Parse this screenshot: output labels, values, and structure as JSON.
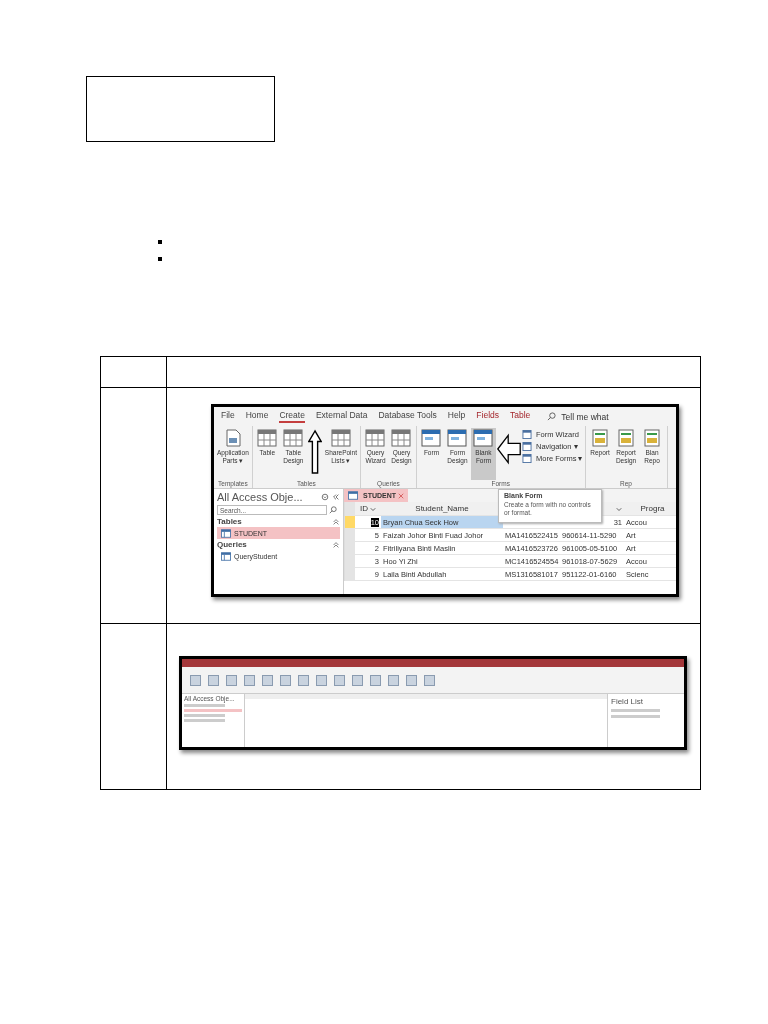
{
  "screenshot_1": {
    "ribbon_tabs": [
      {
        "label": "File",
        "selected": false,
        "kind": "standard"
      },
      {
        "label": "Home",
        "selected": false,
        "kind": "standard"
      },
      {
        "label": "Create",
        "selected": true,
        "kind": "standard"
      },
      {
        "label": "External Data",
        "selected": false,
        "kind": "standard"
      },
      {
        "label": "Database Tools",
        "selected": false,
        "kind": "standard"
      },
      {
        "label": "Help",
        "selected": false,
        "kind": "standard"
      },
      {
        "label": "Fields",
        "selected": false,
        "kind": "contextual"
      },
      {
        "label": "Table",
        "selected": false,
        "kind": "contextual"
      }
    ],
    "tell_me": "Tell me what",
    "ribbon_groups": [
      {
        "kind": "templates",
        "label": "Templates",
        "buttons": [
          {
            "label": "Application Parts ▾",
            "kind": "large",
            "selected": false
          }
        ]
      },
      {
        "kind": "tables",
        "label": "Tables",
        "buttons": [
          {
            "label": "Table",
            "kind": "large",
            "selected": false
          },
          {
            "label": "Table Design",
            "kind": "large",
            "selected": false
          },
          {
            "label": "SharePoint Lists ▾",
            "kind": "large",
            "selected": false
          }
        ]
      },
      {
        "kind": "queries",
        "label": "Queries",
        "buttons": [
          {
            "label": "Query Wizard",
            "kind": "large",
            "selected": false
          },
          {
            "label": "Query Design",
            "kind": "large",
            "selected": false
          }
        ]
      },
      {
        "kind": "forms",
        "label": "Forms",
        "buttons": [
          {
            "label": "Form",
            "kind": "large",
            "selected": false
          },
          {
            "label": "Form Design",
            "kind": "large",
            "selected": false
          },
          {
            "label": "Blank Form",
            "kind": "large",
            "selected": true
          },
          {
            "label": "Form Wizard",
            "kind": "small",
            "selected": false
          },
          {
            "label": "Navigation ▾",
            "kind": "small",
            "selected": false
          },
          {
            "label": "More Forms ▾",
            "kind": "small",
            "selected": false
          }
        ]
      },
      {
        "kind": "reports",
        "label": "Rep",
        "buttons": [
          {
            "label": "Report",
            "kind": "large",
            "selected": false
          },
          {
            "label": "Report Design",
            "kind": "large",
            "selected": false
          },
          {
            "label": "Blan Repo",
            "kind": "large",
            "selected": false
          }
        ]
      }
    ],
    "nav": {
      "title": "All Access Obje...",
      "search_placeholder": "Search...",
      "sections": [
        {
          "label": "Tables",
          "items": [
            {
              "label": "STUDENT",
              "selected": true
            }
          ]
        },
        {
          "label": "Queries",
          "items": [
            {
              "label": "QueryStudent",
              "selected": false
            }
          ]
        }
      ]
    },
    "doc_tab": "STUDENT",
    "columns": [
      {
        "label": "ID"
      },
      {
        "label": "Student_Name"
      },
      {},
      {},
      {
        "label": "Progra"
      }
    ],
    "rows": [
      {
        "selected": true,
        "cells": [
          "10",
          "Bryan Chua Seck How",
          null,
          "31",
          "Accou"
        ]
      },
      {
        "selected": false,
        "cells": [
          "5",
          "Faizah Johor Binti Fuad Johor",
          "MA1416522415",
          "960614-11-5290",
          "Art"
        ]
      },
      {
        "selected": false,
        "cells": [
          "2",
          "Fitriliyana Binti Maslin",
          "MA1416523726",
          "961005-05-5100",
          "Art"
        ]
      },
      {
        "selected": false,
        "cells": [
          "3",
          "Hoo Yi Zhi",
          "MC1416524554",
          "961018-07-5629",
          "Accou"
        ]
      },
      {
        "selected": false,
        "cells": [
          "9",
          "Laila Binti Abdullah",
          "MS1316581017",
          "951122-01-6160",
          "Scienc"
        ]
      }
    ],
    "tooltip": {
      "title": "Blank Form",
      "text": "Create a form with no controls or format."
    }
  },
  "screenshot_2": {
    "nav_title": "All Access Obje...",
    "panel_title": "Field List"
  }
}
